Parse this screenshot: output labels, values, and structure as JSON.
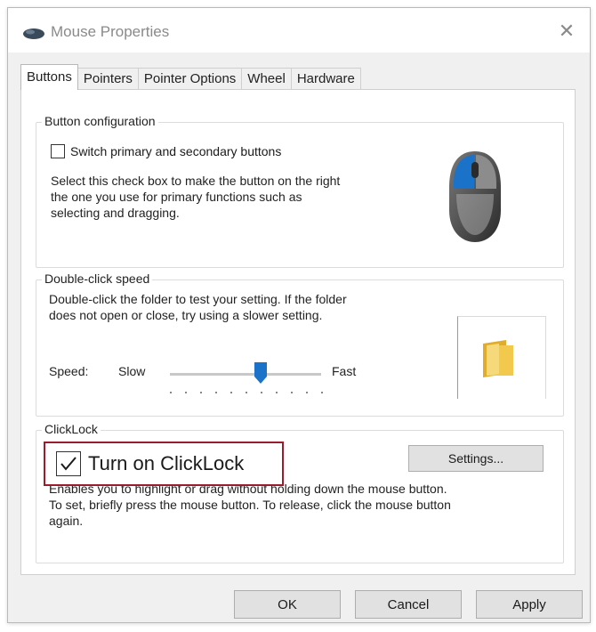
{
  "window": {
    "title": "Mouse Properties",
    "app_icon": "mouse-icon",
    "close_glyph": "✕"
  },
  "tabs": [
    {
      "label": "Buttons",
      "active": true
    },
    {
      "label": "Pointers",
      "active": false
    },
    {
      "label": "Pointer Options",
      "active": false
    },
    {
      "label": "Wheel",
      "active": false
    },
    {
      "label": "Hardware",
      "active": false
    }
  ],
  "button_configuration": {
    "title": "Button configuration",
    "checkbox_label": "Switch primary and secondary buttons",
    "checked": false,
    "description_lines": [
      "Select this check box to make the button on the right",
      "the one you use for primary functions such as",
      "selecting and dragging."
    ]
  },
  "double_click_speed": {
    "title": "Double-click speed",
    "description_lines": [
      "Double-click the folder to test your setting. If the folder",
      "does not open or close, try using a slower setting."
    ],
    "speed_label": "Speed:",
    "slow_label": "Slow",
    "fast_label": "Fast",
    "slider_value_fraction": 0.6
  },
  "clicklock": {
    "title": "ClickLock",
    "checkbox_label": "Turn on ClickLock",
    "checked": true,
    "settings_label": "Settings...",
    "description_lines": [
      "Enables you to highlight or drag without holding down the mouse button.",
      "To set, briefly press the mouse button. To release, click the mouse button",
      "again."
    ]
  },
  "footer": {
    "ok_label": "OK",
    "cancel_label": "Cancel",
    "apply_label": "Apply"
  },
  "colors": {
    "accent_blue": "#1a73c8",
    "highlight_border": "#9b1c2e",
    "folder_yellow": "#f2c94c"
  }
}
